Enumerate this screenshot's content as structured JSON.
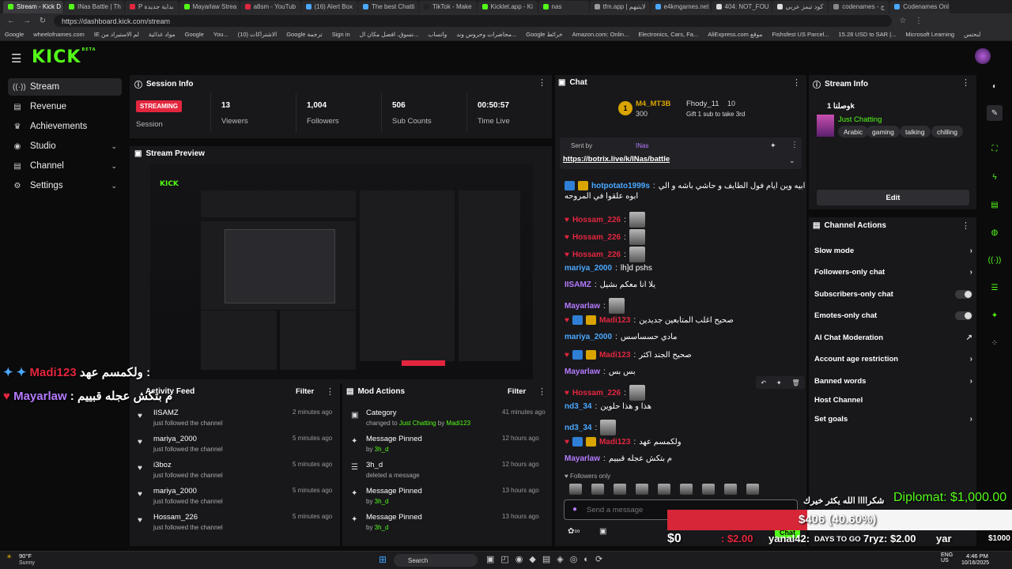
{
  "browser": {
    "tabs": [
      "Stream - Kick D",
      "INas Battle | Th",
      "P بداية جديدة",
      "Mayarlaw Strea",
      "a8sm - YouTub",
      "(16) Alert Box",
      "The best Chatti",
      "TikTok - Make",
      "Kicklet.app - Ki",
      "nas",
      "tfm.app | لايتيهم",
      "e4kmgames.net",
      "404: NOT_FOU",
      "كود تيمز عربي",
      "codenames - ج",
      "Codenames Onl"
    ],
    "url": "https://dashboard.kick.com/stream",
    "bookmarks": [
      "Google",
      "wheelofnames.com",
      "IE لم الاستيراد من",
      "مواد غذائية",
      "Google",
      "You...",
      "(10) الاشتراكات",
      "Google ترجمة",
      "Sign in",
      "تسوق، افضل مكان ال...",
      "واتساب",
      "محاضرات وحروس وند...",
      "Google خرائط",
      "Amazon.com: Onlin...",
      "Electronics, Cars, Fa...",
      "AliExpress.com موقع",
      "Fishsfest US Parcel...",
      "15.28 USD to SAR |...",
      "Microsoft Learning",
      "لنحتس"
    ]
  },
  "sidebar": {
    "items": [
      {
        "label": "Stream",
        "icon": "broadcast-icon"
      },
      {
        "label": "Revenue",
        "icon": "revenue-icon"
      },
      {
        "label": "Achievements",
        "icon": "trophy-icon"
      },
      {
        "label": "Studio",
        "icon": "studio-icon"
      },
      {
        "label": "Channel",
        "icon": "channel-icon"
      },
      {
        "label": "Settings",
        "icon": "gear-icon"
      }
    ]
  },
  "session": {
    "title": "Session Info",
    "badge": "STREAMING",
    "badge_label": "Session",
    "stats": [
      {
        "value": "13",
        "label": "Viewers"
      },
      {
        "value": "1,004",
        "label": "Followers"
      },
      {
        "value": "506",
        "label": "Sub Counts"
      },
      {
        "value": "00:50:57",
        "label": "Time Live"
      }
    ]
  },
  "preview": {
    "title": "Stream Preview"
  },
  "activity": {
    "title": "Activity Feed",
    "filter": "Filter",
    "rows": [
      {
        "name": "IISAMZ",
        "sub": "just followed the channel",
        "time": "2 minutes ago"
      },
      {
        "name": "mariya_2000",
        "sub": "just followed the channel",
        "time": "5 minutes ago"
      },
      {
        "name": "i3boz",
        "sub": "just followed the channel",
        "time": "5 minutes ago"
      },
      {
        "name": "mariya_2000",
        "sub": "just followed the channel",
        "time": "5 minutes ago"
      },
      {
        "name": "Hossam_226",
        "sub": "just followed the channel",
        "time": "5 minutes ago"
      }
    ]
  },
  "mod": {
    "title": "Mod Actions",
    "filter": "Filter",
    "rows": [
      {
        "title": "Category",
        "line2a": "changed to ",
        "line2b": "Just Chatting",
        "line2c": " by ",
        "line2d": "Madi123",
        "time": "41 minutes ago"
      },
      {
        "title": "Message Pinned",
        "line2a": "by ",
        "line2b": "3h_d",
        "time": "12 hours ago"
      },
      {
        "title": "3h_d",
        "line2a": "deleted a message",
        "line2b": "",
        "time": "12 hours ago"
      },
      {
        "title": "Message Pinned",
        "line2a": "by ",
        "line2b": "3h_d",
        "time": "13 hours ago"
      },
      {
        "title": "Message Pinned",
        "line2a": "by ",
        "line2b": "3h_d",
        "time": "13 hours ago"
      }
    ]
  },
  "chat": {
    "title": "Chat",
    "top_user": "M4_MT3B",
    "top_count": "300",
    "gifter": "Fhody_11",
    "gifter_count": "10",
    "gift_text": "Gift 1 sub to take 3rd",
    "pinned_by": "Sent by",
    "pinned_user": "INas",
    "pinned_link": "https://botrix.live/k/INas/battle",
    "messages": [
      {
        "user": "hotpotato1999s",
        "cls": "n-blue",
        "text": "ابيه وين ايام فول الطايف و حاشي باشه و الي",
        "text2": "ابوه علقوا في المروحه"
      },
      {
        "user": "Hossam_226",
        "cls": "n-red",
        "text": "",
        "emote": true
      },
      {
        "user": "Hossam_226",
        "cls": "n-red",
        "text": "",
        "emote": true
      },
      {
        "user": "Hossam_226",
        "cls": "n-red",
        "text": "",
        "emote": true
      },
      {
        "user": "mariya_2000",
        "cls": "n-blue",
        "text": "lh]d pshs"
      },
      {
        "user": "IISAMZ",
        "cls": "n-purple",
        "text": "يلا انا معكم بشيل"
      },
      {
        "user": "Mayarlaw",
        "cls": "n-purple",
        "text": "",
        "emote": true
      },
      {
        "user": "Madi123",
        "cls": "n-red",
        "text": "صحيح اغلب المتابعين جديدين"
      },
      {
        "user": "mariya_2000",
        "cls": "n-blue",
        "text": "مادي حسساسس"
      },
      {
        "user": "Madi123",
        "cls": "n-red",
        "text": "صحيح الجند اكثر"
      },
      {
        "user": "Mayarlaw",
        "cls": "n-purple",
        "text": "بس بس"
      },
      {
        "user": "Hossam_226",
        "cls": "n-red",
        "text": "",
        "emote": true
      },
      {
        "user": "nd3_34",
        "cls": "n-blue",
        "text": "هذا و هذا حلوين"
      },
      {
        "user": "nd3_34",
        "cls": "n-blue",
        "text": "",
        "emote": true
      },
      {
        "user": "Madi123",
        "cls": "n-red",
        "text": "ولكمسم عهد"
      },
      {
        "user": "Mayarlaw",
        "cls": "n-purple",
        "text": "م بتكش عجله قبييم"
      }
    ],
    "followers_only": "Followers only",
    "placeholder": "Send a message",
    "chat_button": "Chat"
  },
  "streaminfo": {
    "title": "Stream Info",
    "stream_title": "وصلنا 1k",
    "category": "Just Chatting",
    "tags": [
      "Arabic",
      "gaming",
      "talking",
      "chilling"
    ],
    "edit": "Edit"
  },
  "actions": {
    "title": "Channel Actions",
    "items": [
      {
        "label": "Slow mode",
        "type": "arrow"
      },
      {
        "label": "Followers-only chat",
        "type": "arrow"
      },
      {
        "label": "Subscribers-only chat",
        "type": "toggle"
      },
      {
        "label": "Emotes-only chat",
        "type": "toggle"
      },
      {
        "label": "AI Chat Moderation",
        "type": "ext"
      },
      {
        "label": "Account age restriction",
        "type": "arrow"
      },
      {
        "label": "Banned words",
        "type": "arrow"
      },
      {
        "label": "Host Channel",
        "type": "none"
      },
      {
        "label": "Set goals",
        "type": "arrow"
      }
    ]
  },
  "overlay": {
    "left1": "ولكمسم عهد :",
    "left1_user": "Madi123",
    "left2_user": "Mayarlaw",
    "left2": ": م بتكش عجله قبييم",
    "thanks": "شكراااا الله يكثر خيرك",
    "diplomat": "Diplomat: $1,000.00",
    "progress_text": "$406 (40.60%)",
    "progress_fraction": 0.406,
    "zero": "$0",
    "line1": ": $2.00",
    "yanal": "yanal42:",
    "days": "DAYS TO GO",
    "ryz": "7ryz: $2.00",
    "yar": "yar",
    "thousand": "$1000"
  },
  "taskbar": {
    "weather_temp": "90°F",
    "weather_desc": "Sunny",
    "search": "Search",
    "lang": "ENG",
    "region": "US",
    "time": "4:46 PM",
    "date": "10/16/2025"
  },
  "colors": {
    "accent": "#53fc18",
    "streaming": "#e3263e",
    "panel": "#18181b"
  }
}
